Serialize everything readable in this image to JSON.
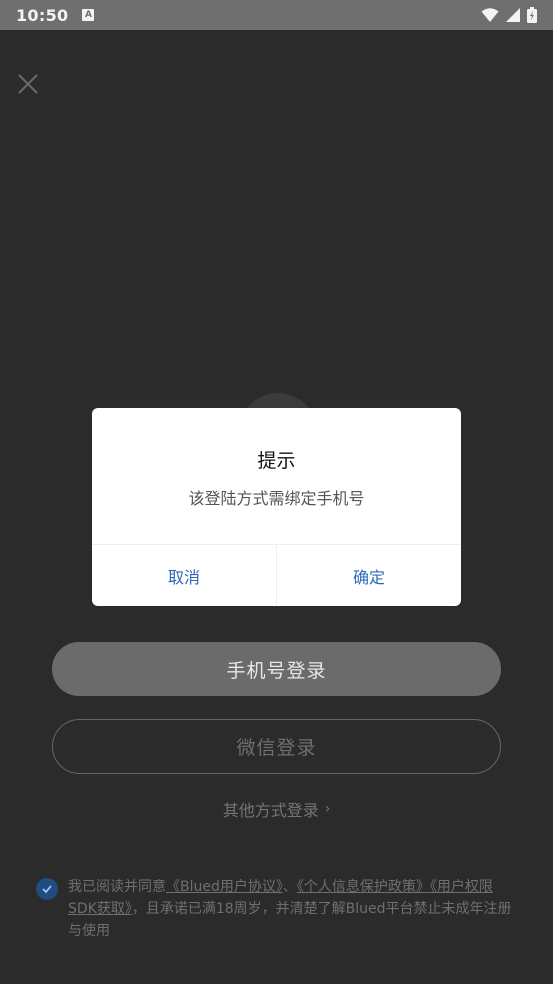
{
  "status_bar": {
    "time": "10:50",
    "notification_badge": "A"
  },
  "screen": {
    "phone_login_label": "手机号登录",
    "wechat_login_label": "微信登录",
    "other_login_label": "其他方式登录",
    "agreement": {
      "prefix": "我已阅读并同意",
      "link_user_agreement": "《Blued用户协议》",
      "sep1": "、",
      "link_privacy_policy": "《个人信息保护政策》",
      "link_permissions": "《用户权限SDK获取》",
      "suffix": "，且承诺已满18周岁，并清楚了解Blued平台禁止未成年注册与使用",
      "checked": true
    }
  },
  "dialog": {
    "title": "提示",
    "message": "该登陆方式需绑定手机号",
    "cancel_label": "取消",
    "confirm_label": "确定"
  },
  "colors": {
    "background": "#2b2b2b",
    "accent": "#2e69b5",
    "checkbox": "#1f4d80"
  }
}
